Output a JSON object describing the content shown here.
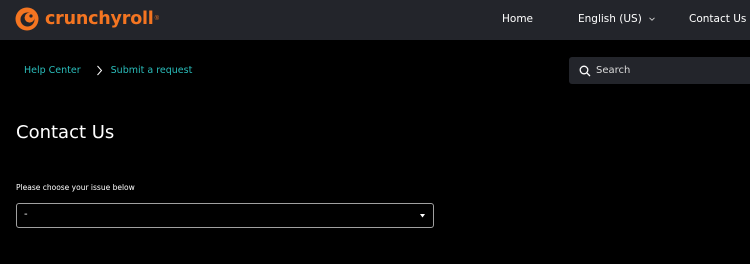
{
  "brand": {
    "name": "crunchyroll",
    "trademark": "®",
    "color": "#f47521"
  },
  "nav": {
    "home": "Home",
    "language": "English (US)",
    "contact": "Contact Us"
  },
  "breadcrumb": {
    "items": [
      "Help Center",
      "Submit a request"
    ],
    "color": "#2abdbb"
  },
  "search": {
    "placeholder": "Search",
    "value": ""
  },
  "page": {
    "title": "Contact Us"
  },
  "form": {
    "issue_label": "Please choose your issue below",
    "issue_selected": "-"
  },
  "icons": {
    "logo": "crunchyroll-logo-icon",
    "language_dropdown": "chevron-down-icon",
    "breadcrumb_separator": "chevron-right-icon",
    "search": "search-icon",
    "select_arrow": "caret-down-icon"
  },
  "colors": {
    "header_bg": "#23252b",
    "page_bg": "#000000",
    "text": "#ffffff"
  }
}
